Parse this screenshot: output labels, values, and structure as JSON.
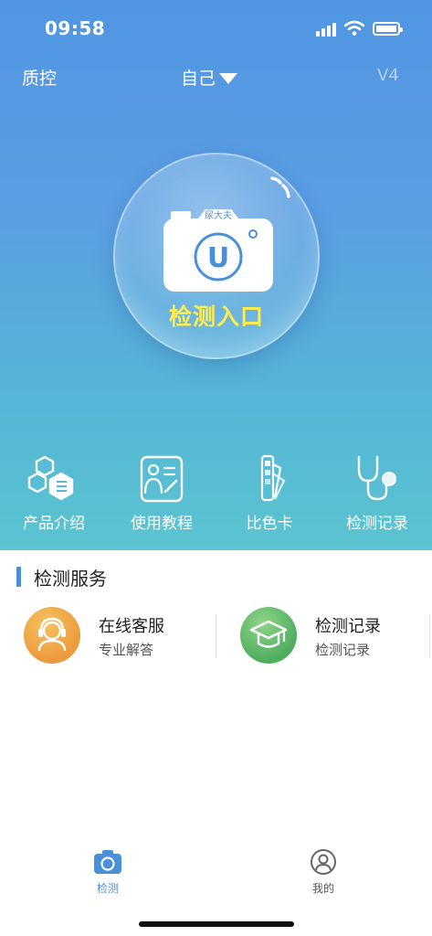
{
  "status_bar": {
    "time": "09:58"
  },
  "header": {
    "left_label": "质控",
    "profile_label": "自己",
    "version": "V4"
  },
  "entry": {
    "label": "检测入口",
    "camera_badge": "尿大夫",
    "camera_logo_letter": "U"
  },
  "features": [
    {
      "label": "产品介绍",
      "icon": "hexagon-list-icon"
    },
    {
      "label": "使用教程",
      "icon": "tutorial-card-icon"
    },
    {
      "label": "比色卡",
      "icon": "color-swatch-icon"
    },
    {
      "label": "检测记录",
      "icon": "stethoscope-icon"
    }
  ],
  "services": {
    "title": "检测服务",
    "items": [
      {
        "title": "在线客服",
        "subtitle": "专业解答",
        "icon": "agent-headset-icon",
        "color": "#ec9a3e"
      },
      {
        "title": "检测记录",
        "subtitle": "检测记录",
        "icon": "graduation-cap-icon",
        "color": "#5fbb6a"
      }
    ]
  },
  "tabbar": {
    "items": [
      {
        "label": "检测",
        "icon": "camera-icon",
        "active": true
      },
      {
        "label": "我的",
        "icon": "user-icon",
        "active": false
      }
    ],
    "active_color": "#4a90d9",
    "inactive_color": "#555555"
  },
  "colors": {
    "hero_top": "#5096e2",
    "hero_bottom": "#5ac4cf",
    "entry_text": "#ffee4a",
    "accent": "#4a90d9"
  }
}
